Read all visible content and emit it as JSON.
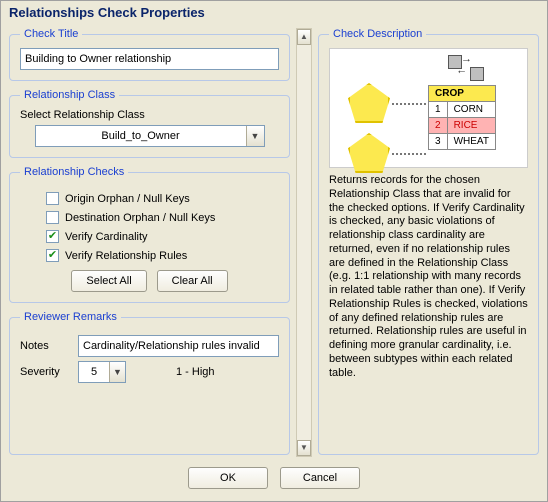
{
  "window": {
    "title": "Relationships Check Properties"
  },
  "groups": {
    "check_title": "Check Title",
    "rel_class": "Relationship Class",
    "rel_checks": "Relationship Checks",
    "reviewer": "Reviewer Remarks",
    "description": "Check Description"
  },
  "check_title_value": "Building to Owner relationship",
  "rel_class_label": "Select Relationship Class",
  "rel_class_value": "Build_to_Owner",
  "checks": {
    "origin": {
      "label": "Origin Orphan / Null Keys",
      "checked": false
    },
    "dest": {
      "label": "Destination Orphan / Null Keys",
      "checked": false
    },
    "cardinality": {
      "label": "Verify Cardinality",
      "checked": true
    },
    "rules": {
      "label": "Verify Relationship Rules",
      "checked": true
    }
  },
  "buttons": {
    "select_all": "Select All",
    "clear_all": "Clear All",
    "ok": "OK",
    "cancel": "Cancel"
  },
  "reviewer": {
    "notes_label": "Notes",
    "notes_value": "Cardinality/Relationship rules invalid",
    "severity_label": "Severity",
    "severity_value": "5",
    "severity_hint": "1 - High"
  },
  "description_text": "Returns records for the chosen Relationship Class that are invalid for the checked options.   If Verify Cardinality is checked, any basic violations of relationship class cardinality are returned, even if no relationship rules are defined in the Relationship Class (e.g. 1:1 relationship with many records in related table rather than one).  If Verify Relationship Rules is checked, violations of any defined relationship rules are returned.  Relationship rules are useful in defining more granular cardinality, i.e. between subtypes within each related table.",
  "diagram": {
    "table_header": "CROP",
    "rows": [
      {
        "n": "1",
        "v": "CORN",
        "hl": false
      },
      {
        "n": "2",
        "v": "RICE",
        "hl": true
      },
      {
        "n": "3",
        "v": "WHEAT",
        "hl": false
      }
    ]
  }
}
